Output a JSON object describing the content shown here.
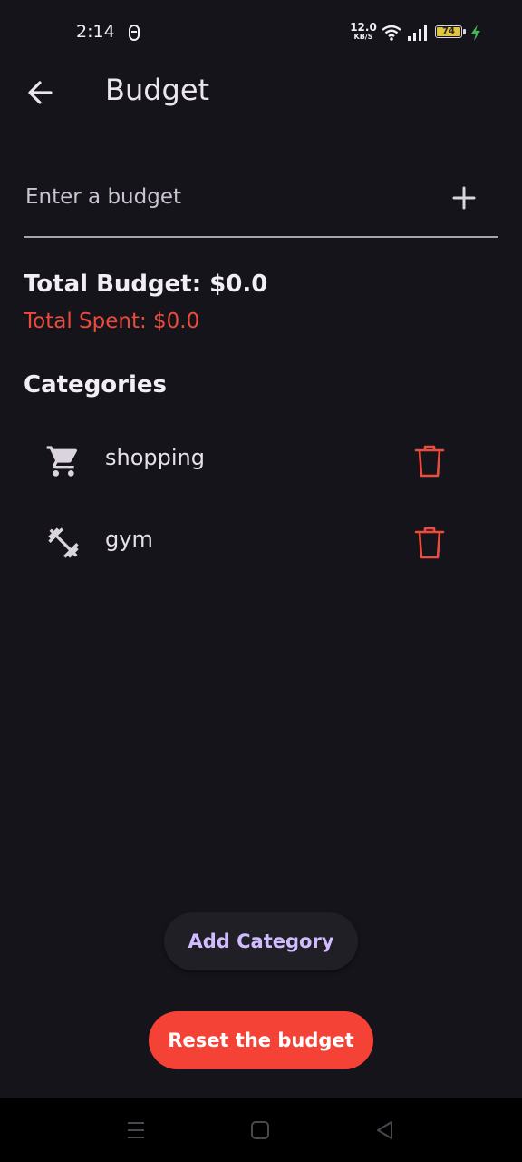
{
  "status_bar": {
    "time": "2:14",
    "net_speed_value": "12.0",
    "net_speed_unit": "KB/S",
    "battery_level": "74"
  },
  "app_bar": {
    "title": "Budget",
    "back_icon": "arrow-back-icon"
  },
  "budget_input": {
    "placeholder": "Enter a budget",
    "value": "",
    "add_icon": "plus-icon"
  },
  "totals": {
    "budget": "Total Budget: $0.0",
    "spent": "Total Spent: $0.0"
  },
  "categories": {
    "heading": "Categories",
    "items": [
      {
        "icon": "shopping-cart-icon",
        "label": "shopping",
        "delete_icon": "trash-icon"
      },
      {
        "icon": "dumbbell-icon",
        "label": "gym",
        "delete_icon": "trash-icon"
      }
    ]
  },
  "actions": {
    "add_category": "Add Category",
    "reset_budget": "Reset the budget"
  },
  "colors": {
    "background": "#16141b",
    "accent": "#d0bcff",
    "danger": "#f44336",
    "spent_text": "#ec4a3c"
  },
  "nav_bar": {
    "icons": [
      "menu-icon",
      "home-icon",
      "back-triangle-icon"
    ]
  }
}
